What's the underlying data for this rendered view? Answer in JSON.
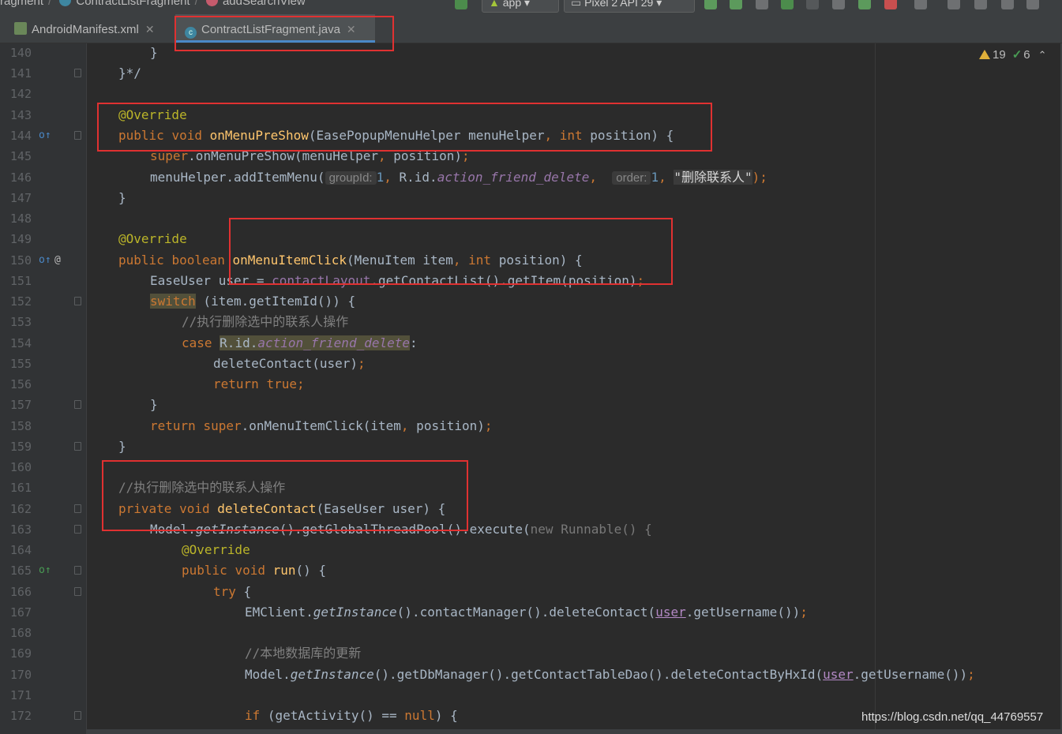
{
  "navbar": {
    "breadcrumb": [
      "ragment",
      "ContractListFragment",
      "addSearchView"
    ],
    "run_config": "app",
    "device": "Pixel 2 API 29"
  },
  "tabs": [
    {
      "label": "AndroidManifest.xml",
      "active": false,
      "icon": "xml-file-icon"
    },
    {
      "label": "ContractListFragment.java",
      "active": true,
      "icon": "java-class-icon"
    }
  ],
  "inspection": {
    "warnings": "19",
    "typos": "6"
  },
  "line_numbers": [
    "140",
    "141",
    "142",
    "143",
    "144",
    "145",
    "146",
    "147",
    "148",
    "149",
    "150",
    "151",
    "152",
    "153",
    "154",
    "155",
    "156",
    "157",
    "158",
    "159",
    "160",
    "161",
    "162",
    "163",
    "164",
    "165",
    "166",
    "167",
    "168",
    "169",
    "170",
    "171",
    "172"
  ],
  "code": {
    "l140": "}",
    "l141": "}*/",
    "l143": "@Override",
    "l144": {
      "kw1": "public",
      "kw2": "void",
      "fn": "onMenuPreShow",
      "a": "(EasePopupMenuHelper menuHelper",
      "comma": ",",
      "kw3": "int",
      "b": " position) {"
    },
    "l145": {
      "sup": "super",
      "rest": ".onMenuPreShow(menuHelper",
      "comma": ",",
      "rest2": " position)",
      "semi": ";"
    },
    "l146": {
      "a": "menuHelper.addItemMenu(",
      "hint1": "groupId:",
      "n1": "1",
      "c1": ",",
      "b": " R.id.",
      "f": "action_friend_delete",
      "c2": ",",
      "hint2": "order:",
      "n2": "1",
      "c3": ",",
      "s": "\"删除联系人\"",
      "end": ");"
    },
    "l147": "}",
    "l149": "@Override",
    "l150": {
      "kw1": "public",
      "kw2": "boolean",
      "fn": "onMenuItemClick",
      "a": "(MenuItem item",
      "comma": ",",
      "kw3": "int",
      "b": " position) {"
    },
    "l151": {
      "a": "EaseUser user = ",
      "f": "contactLayout",
      "b": ".getContactList().getItem(position)",
      "semi": ";"
    },
    "l152": {
      "kw": "switch",
      "rest": " (item.getItemId()) {"
    },
    "l153": "//执行删除选中的联系人操作",
    "l154": {
      "kw": "case",
      "a": "R.id.",
      "f": "action_friend_delete",
      "b": ":"
    },
    "l155": {
      "a": "deleteContact(user)",
      "semi": ";"
    },
    "l156": {
      "kw1": "return",
      "kw2": "true",
      "semi": ";"
    },
    "l157": "}",
    "l158": {
      "kw": "return",
      "sup": "super",
      "a": ".onMenuItemClick(item",
      "c": ",",
      "b": " position)",
      "semi": ";"
    },
    "l159": "}",
    "l161": "//执行删除选中的联系人操作",
    "l162": {
      "kw1": "private",
      "kw2": "void",
      "fn": "deleteContact",
      "a": "(EaseUser user) {"
    },
    "l163": {
      "a": "Model.",
      "s1": "getInstance",
      "b": "().getGlobalThreadPool().execute(",
      "kw": "new",
      "c": " Runnable() {"
    },
    "l164": "@Override",
    "l165": {
      "kw1": "public",
      "kw2": "void",
      "fn": "run",
      "a": "() {"
    },
    "l166": {
      "kw": "try",
      "a": " {"
    },
    "l167": {
      "a": "EMClient.",
      "s1": "getInstance",
      "b": "().contactManager().deleteContact(",
      "p": "user",
      "c": ".getUsername())",
      "semi": ";"
    },
    "l169": "//本地数据库的更新",
    "l170": {
      "a": "Model.",
      "s1": "getInstance",
      "b": "().getDbManager().getContactTableDao().deleteContactByHxId(",
      "p": "user",
      "c": ".getUsername())",
      "semi": ";"
    },
    "l172": {
      "kw": "if",
      "a": " (getActivity() == ",
      "kw2": "null",
      "b": ") {"
    }
  },
  "watermark": "https://blog.csdn.net/qq_44769557",
  "colors": {
    "annotation_box": "#e03131",
    "editor_bg": "#2b2b2b",
    "keyword": "#cc7832",
    "method": "#ffc66d"
  }
}
